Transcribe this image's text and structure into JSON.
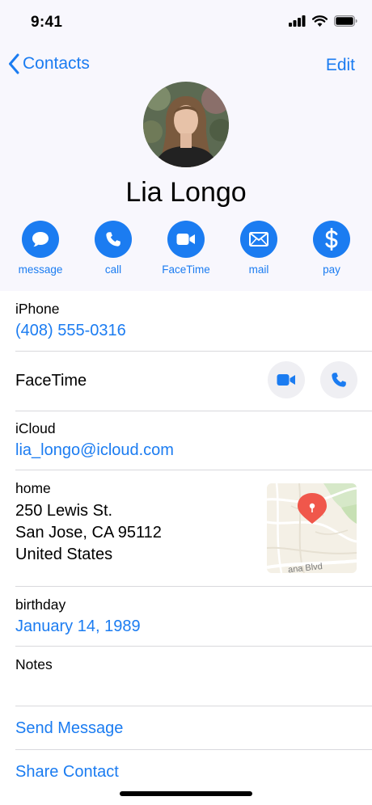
{
  "status_bar": {
    "time": "9:41"
  },
  "nav": {
    "back_label": "Contacts",
    "edit_label": "Edit"
  },
  "contact": {
    "name": "Lia Longo"
  },
  "actions": [
    {
      "label": "message",
      "icon": "message-bubble-icon"
    },
    {
      "label": "call",
      "icon": "phone-icon"
    },
    {
      "label": "FaceTime",
      "icon": "video-camera-icon"
    },
    {
      "label": "mail",
      "icon": "envelope-icon"
    },
    {
      "label": "pay",
      "icon": "dollar-icon"
    }
  ],
  "fields": {
    "phone": {
      "label": "iPhone",
      "value": "(408) 555-0316"
    },
    "facetime": {
      "label": "FaceTime"
    },
    "icloud": {
      "label": "iCloud",
      "value": "lia_longo@icloud.com"
    },
    "home": {
      "label": "home",
      "line1": "250 Lewis St.",
      "line2": "San Jose, CA 95112",
      "line3": "United States",
      "map_street": "ana Blvd"
    },
    "birthday": {
      "label": "birthday",
      "value": "January 14, 1989"
    },
    "notes": {
      "label": "Notes"
    }
  },
  "links": {
    "send_message": "Send Message",
    "share_contact": "Share Contact"
  },
  "colors": {
    "accent": "#1b7cf1",
    "header_bg": "#f8f7fd",
    "map_pin": "#f0574b"
  }
}
